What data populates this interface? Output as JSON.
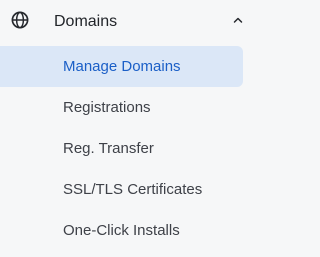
{
  "section": {
    "title": "Domains",
    "icon": "globe-icon",
    "expand_icon": "chevron-up-icon"
  },
  "items": [
    {
      "label": "Manage Domains",
      "active": true
    },
    {
      "label": "Registrations",
      "active": false
    },
    {
      "label": "Reg. Transfer",
      "active": false
    },
    {
      "label": "SSL/TLS Certificates",
      "active": false
    },
    {
      "label": "One-Click Installs",
      "active": false
    }
  ],
  "colors": {
    "background": "#f6f7f8",
    "active_background": "#dbe7f7",
    "active_text": "#1b5fc7",
    "text": "#3e4148",
    "heading": "#22252a"
  }
}
